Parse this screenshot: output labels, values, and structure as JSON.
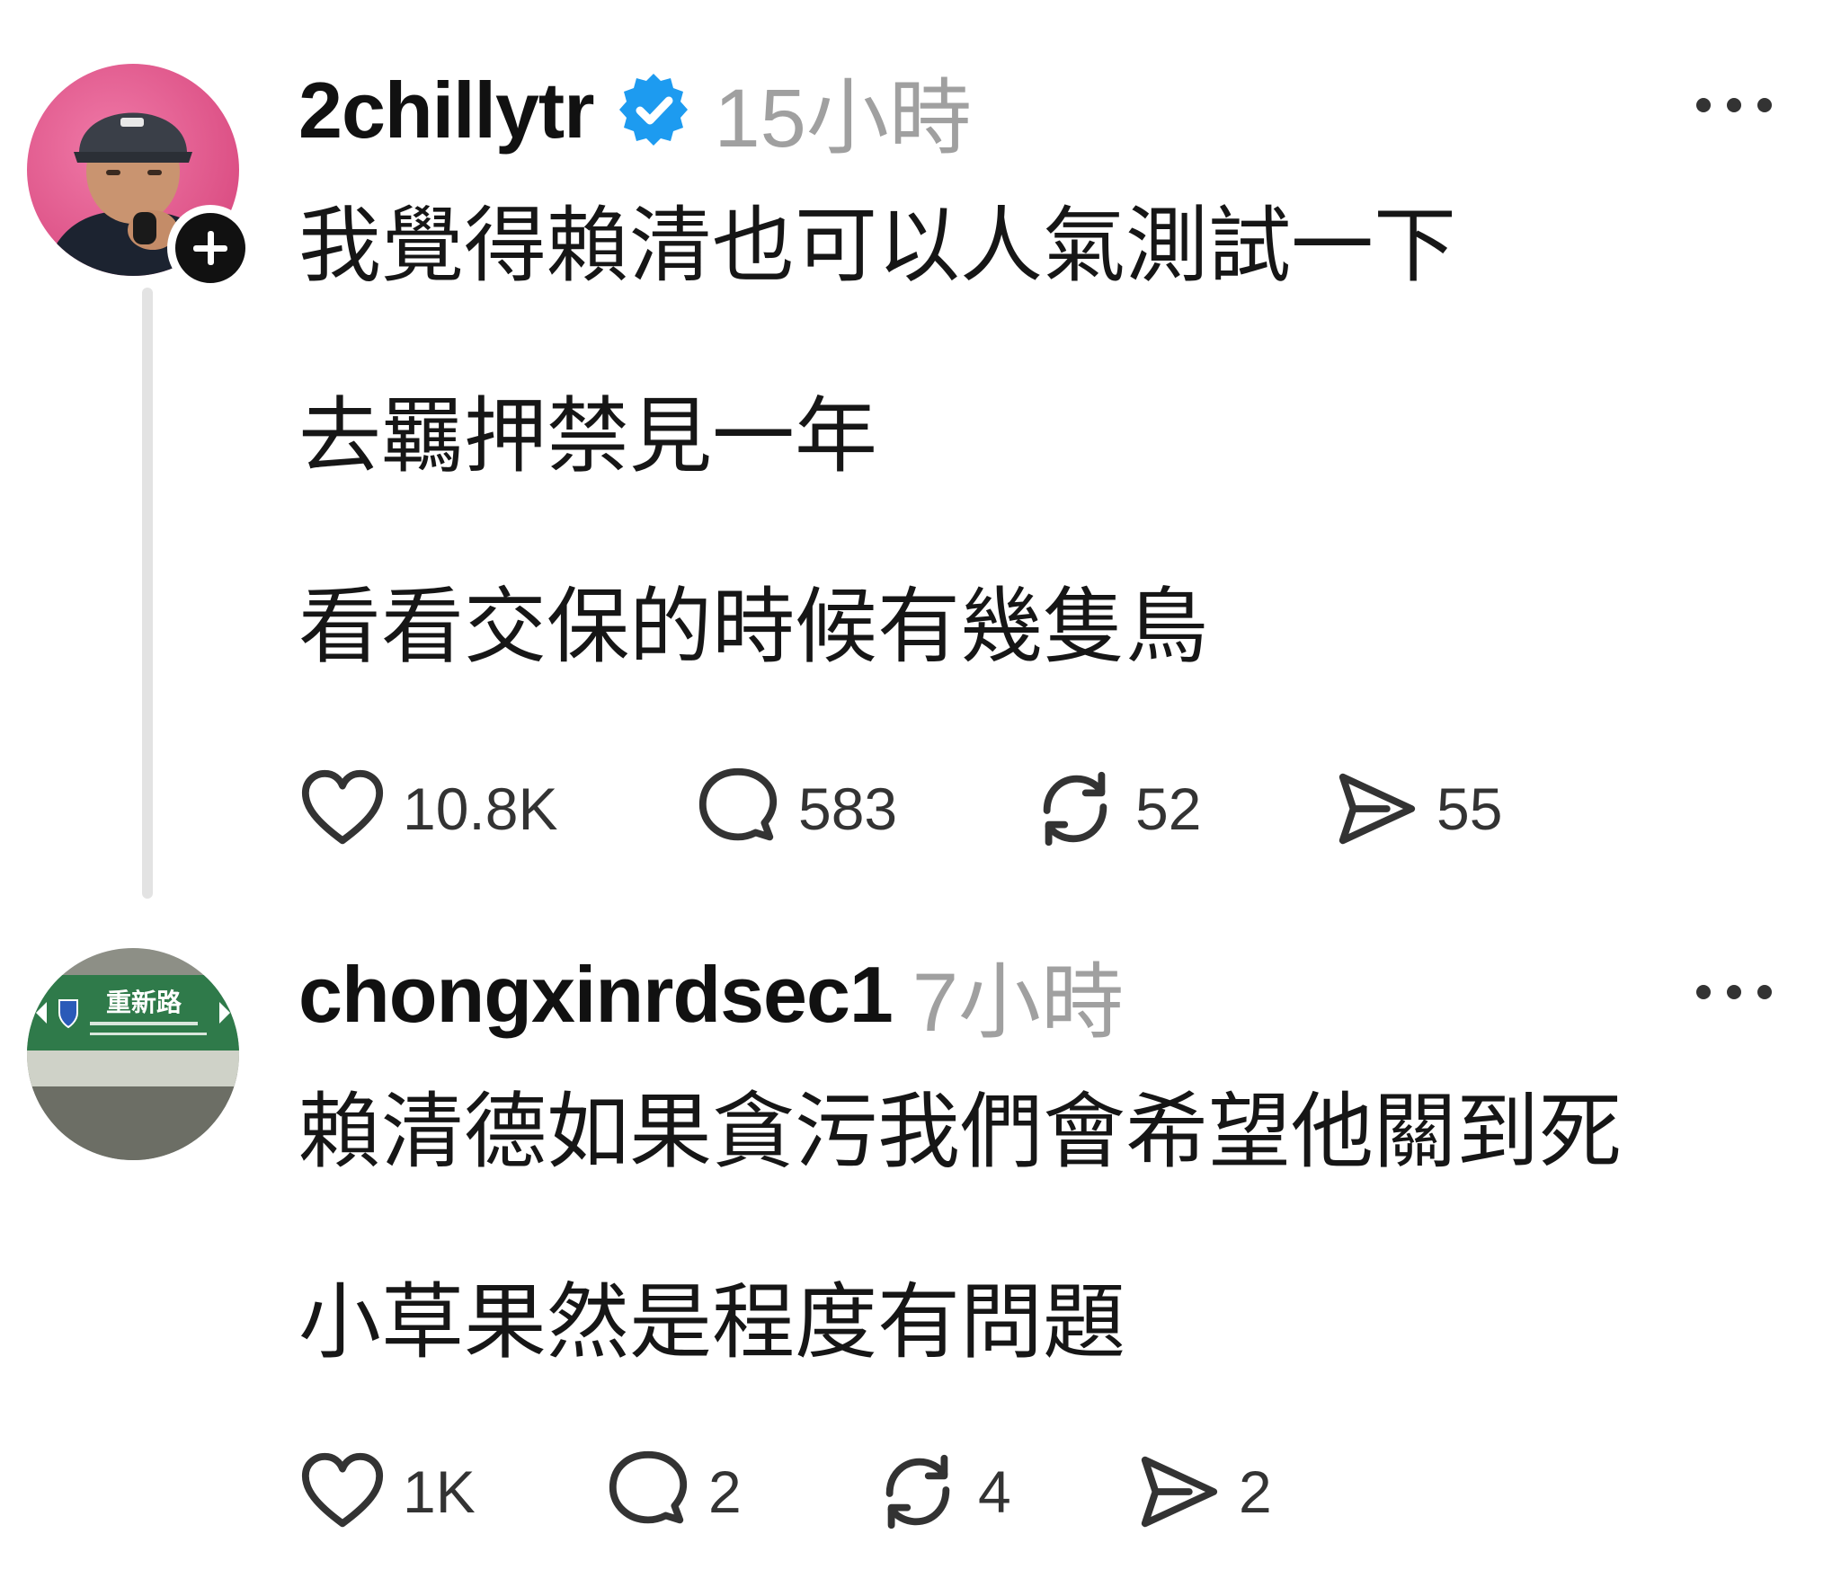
{
  "colors": {
    "verified_blue": "#1d9bf0",
    "timestamp_gray": "#a0a0a0",
    "text": "#111111",
    "thread_line": "#e3e3e3"
  },
  "posts": [
    {
      "username": "2chillytr",
      "verified": true,
      "timestamp": "15小時",
      "avatar_icon": "user-avatar",
      "follow_icon": "plus-icon",
      "more_icon": "ellipsis-icon",
      "body": [
        "我覺得賴清也可以人氣測試一下",
        "去羈押禁見一年",
        "看看交保的時候有幾隻鳥"
      ],
      "actions": {
        "likes": "10.8K",
        "replies": "583",
        "reposts": "52",
        "shares": "55"
      }
    },
    {
      "username": "chongxinrdsec1",
      "verified": false,
      "timestamp": "7小時",
      "avatar_icon": "street-sign-avatar",
      "avatar_sign_text": "重新路",
      "more_icon": "ellipsis-icon",
      "body": [
        "賴清德如果貪污我們會希望他關到死",
        "小草果然是程度有問題"
      ],
      "actions": {
        "likes": "1K",
        "replies": "2",
        "reposts": "4",
        "shares": "2"
      }
    }
  ]
}
